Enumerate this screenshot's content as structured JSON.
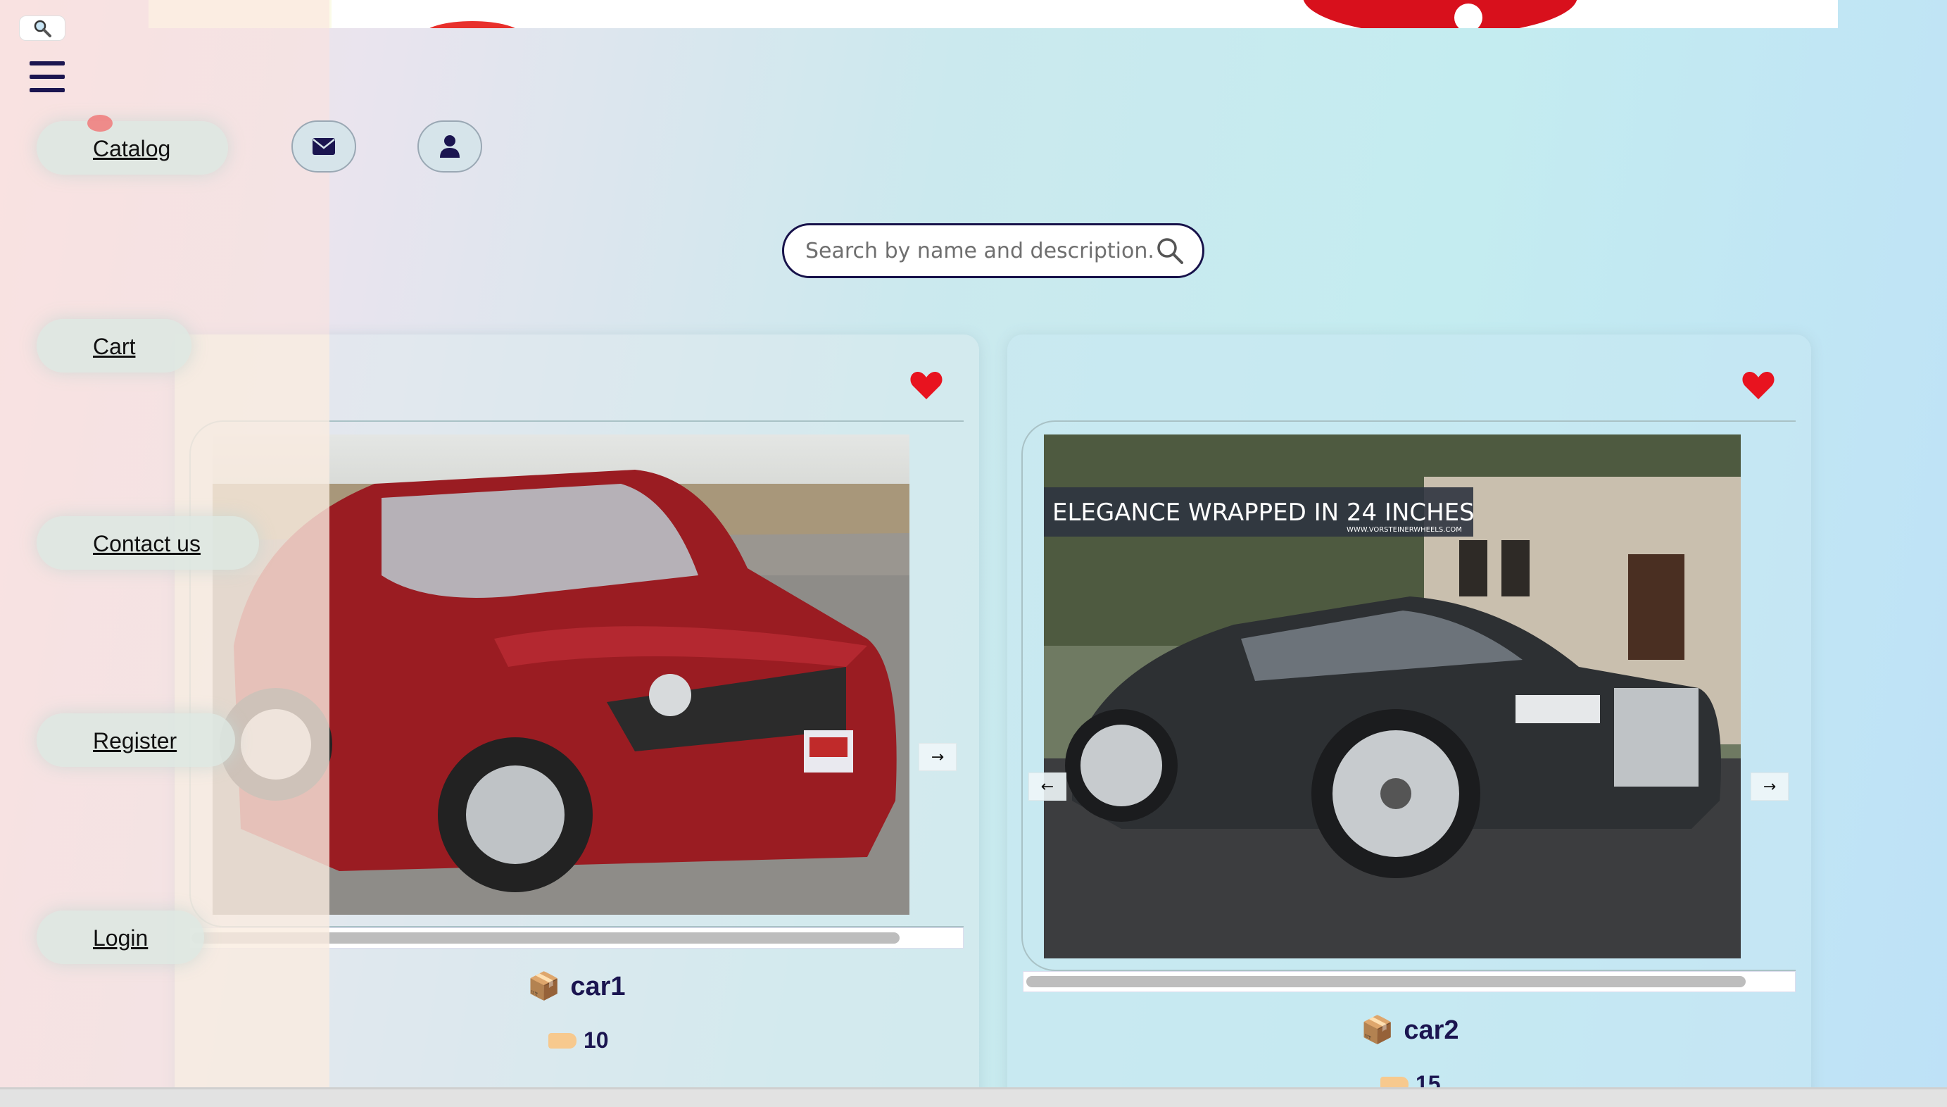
{
  "sidebar": {
    "search_toggle_icon": "search-icon",
    "menu_icon": "hamburger-icon",
    "items": [
      {
        "label": "Catalog"
      },
      {
        "label": "Cart"
      },
      {
        "label": "Contact us"
      },
      {
        "label": "Register"
      },
      {
        "label": "Login"
      }
    ]
  },
  "header": {
    "mail_icon": "envelope-icon",
    "user_icon": "user-icon"
  },
  "search": {
    "placeholder": "Search by name and description...",
    "value": "",
    "icon": "magnifier-icon"
  },
  "products": [
    {
      "name": "car1",
      "price": "10",
      "favorite": true,
      "name_icon": "package-icon",
      "price_icon": "price-tag-icon"
    },
    {
      "name": "car2",
      "price": "15",
      "favorite": true,
      "name_icon": "package-icon",
      "price_icon": "price-tag-icon",
      "photo_caption": "ELEGANCE WRAPPED IN 24 INCHES",
      "photo_subcaption": "WWW.VORSTEINERWHEELS.COM"
    }
  ],
  "colors": {
    "accent_navy": "#1b1550",
    "heart_red": "#e8131f"
  }
}
